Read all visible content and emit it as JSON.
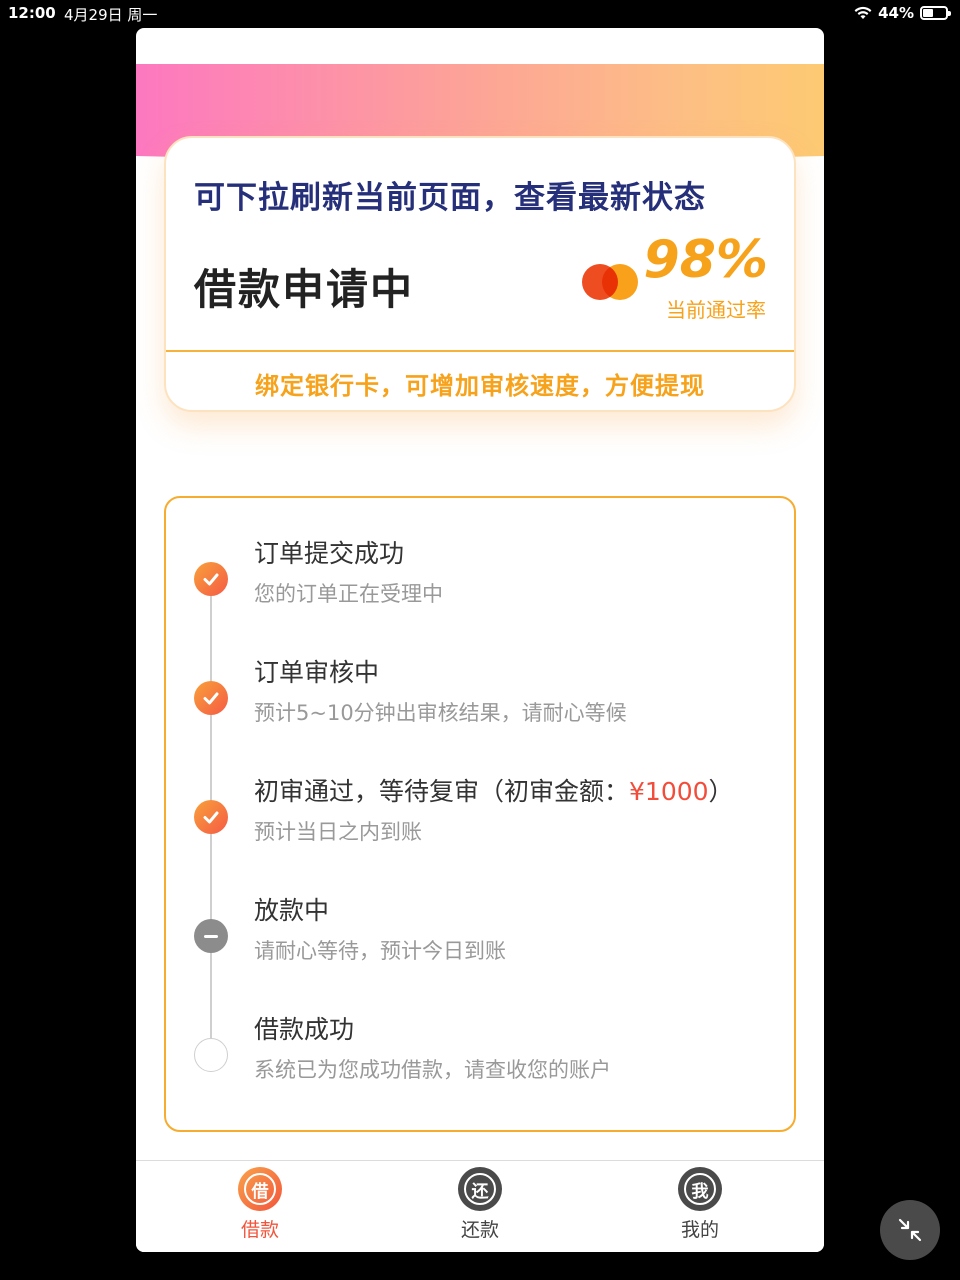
{
  "status_bar": {
    "time": "12:00",
    "date": "4月29日 周一",
    "battery": "44%",
    "battery_level": 0.44
  },
  "status_card": {
    "refresh_tip": "可下拉刷新当前页面，查看最新状态",
    "status_title": "借款申请中",
    "pass_rate": "98%",
    "pass_rate_label": "当前通过率",
    "bind_tip": "绑定银行卡，可增加审核速度，方便提现"
  },
  "progress": {
    "steps": [
      {
        "title": "订单提交成功",
        "desc": "您的订单正在受理中",
        "state": "done"
      },
      {
        "title": "订单审核中",
        "desc": "预计5~10分钟出审核结果，请耐心等候",
        "state": "done"
      },
      {
        "title_prefix": "初审通过，等待复审（初审金额：",
        "amount": "¥1000",
        "title_suffix": "）",
        "desc": "预计当日之内到账",
        "state": "done"
      },
      {
        "title": "放款中",
        "desc": "请耐心等待，预计今日到账",
        "state": "doing"
      },
      {
        "title": "借款成功",
        "desc": "系统已为您成功借款，请查收您的账户",
        "state": "todo"
      }
    ]
  },
  "tabbar": {
    "tabs": [
      {
        "label": "借款",
        "icon_char": "借",
        "active": true
      },
      {
        "label": "还款",
        "icon_char": "还",
        "active": false
      },
      {
        "label": "我的",
        "icon_char": "我",
        "active": false
      }
    ]
  },
  "colors": {
    "accent_orange": "#f7a21b",
    "accent_red": "#f24d3a",
    "title_navy": "#26307a"
  },
  "icons": {
    "float_button": "collapse-arrows-icon",
    "check": "check-icon"
  }
}
